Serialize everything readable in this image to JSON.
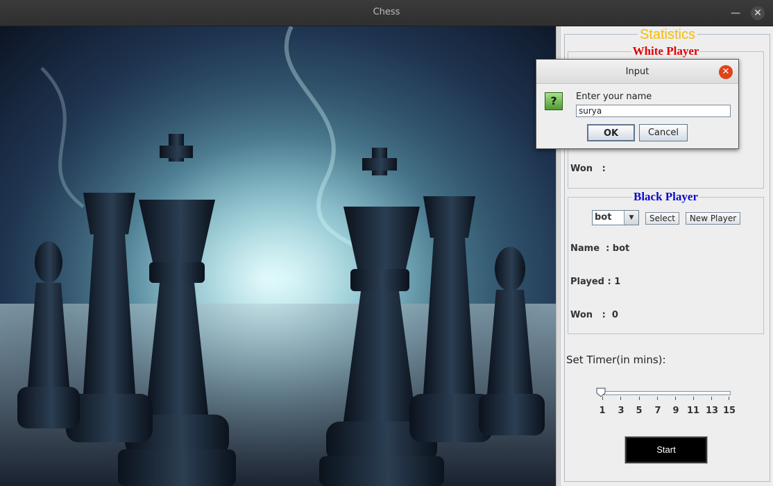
{
  "window": {
    "title": "Chess",
    "minimize_icon": "minimize-icon",
    "close_icon": "close-icon"
  },
  "stats": {
    "title": "Statistics",
    "white_player": {
      "title": "White Player",
      "won_label": "Won   :"
    },
    "black_player": {
      "title": "Black Player",
      "selected_player": "bot",
      "select_label": "Select",
      "new_player_label": "New Player",
      "name_line": "Name  : bot",
      "played_line": "Played : 1",
      "won_line": "Won   :  0"
    },
    "timer": {
      "label": "Set Timer(in mins):",
      "ticks": [
        "1",
        "3",
        "5",
        "7",
        "9",
        "11",
        "13",
        "15"
      ],
      "value": 1
    },
    "start_label": "Start"
  },
  "dialog": {
    "title": "Input",
    "prompt": "Enter your name",
    "input_value": "surya",
    "ok_label": "OK",
    "cancel_label": "Cancel",
    "icon": "question-icon"
  },
  "colors": {
    "statistics_title": "#f4bd00",
    "white_player_title": "#e10000",
    "black_player_title": "#0a0acc"
  }
}
